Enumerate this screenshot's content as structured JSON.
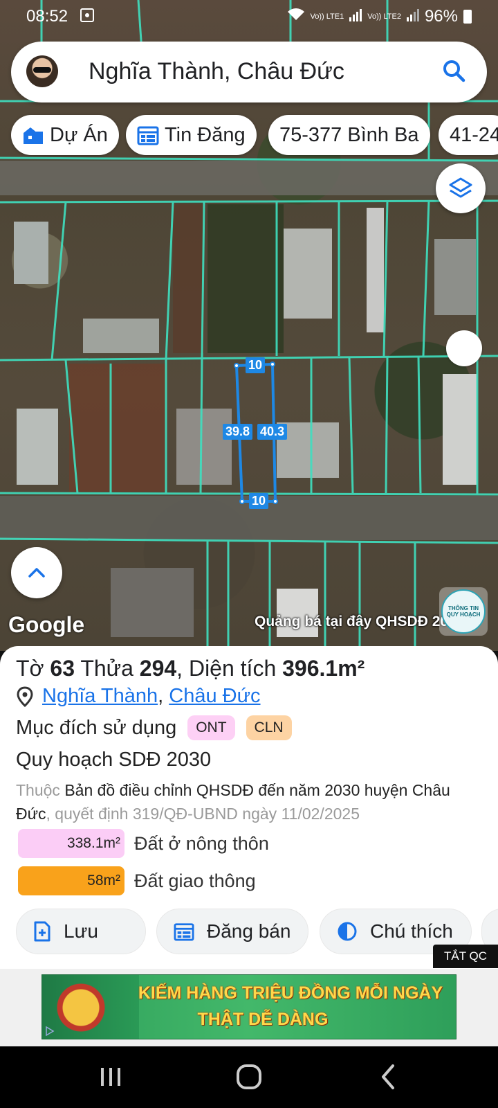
{
  "status_bar": {
    "time": "08:52",
    "signal_1": "Vo)) LTE1",
    "signal_2": "Vo)) LTE2",
    "battery": "96%"
  },
  "search": {
    "query": "Nghĩa Thành, Châu Đức",
    "search_icon": "search-icon",
    "avatar": "avatar"
  },
  "chips": [
    {
      "label": "Dự Án",
      "icon": "building-icon"
    },
    {
      "label": "Tin Đăng",
      "icon": "listing-icon"
    },
    {
      "label": "75-377 Bình Ba",
      "icon": ""
    },
    {
      "label": "41-24",
      "icon": ""
    }
  ],
  "map": {
    "measurements": {
      "top": "10",
      "bottom": "10",
      "left": "39.8",
      "right": "40.3"
    },
    "google_label": "Google",
    "promo_text": "Quảng bá tại đây QHSDĐ 2030",
    "logo_text": "THÔNG TIN QUY HOẠCH",
    "colors": {
      "boundary": "#3fe0c0",
      "parcel": "#1e88e5"
    }
  },
  "parcel": {
    "to_label": "Tờ",
    "to_value": "63",
    "thua_label": "Thửa",
    "thua_value": "294",
    "area_label": ", Diện tích",
    "area_value": "396.1m²",
    "location_1": "Nghĩa Thành",
    "location_sep": ",",
    "location_2": "Châu Đức",
    "purpose_label": "Mục đích sử dụng",
    "purpose_tags": [
      "ONT",
      "CLN"
    ],
    "plan_title": "Quy hoạch SDĐ 2030",
    "plan_prefix": "Thuộc",
    "plan_name": "Bản đồ điều chỉnh QHSDĐ đến năm 2030 huyện Châu Đức",
    "plan_decision": ", quyết định 319/QĐ-UBND ngày 11/02/2025",
    "areas": [
      {
        "value": "338.1m²",
        "label": "Đất ở nông thôn",
        "color": "#fbcdf6"
      },
      {
        "value": "58m²",
        "label": "Đất giao thông",
        "color": "#f9a21b"
      }
    ],
    "tag_colors": {
      "ONT": "#fdd0f5",
      "CLN": "#fdd3a3"
    }
  },
  "actions": [
    {
      "label": "Lưu",
      "icon": "add-file-icon"
    },
    {
      "label": "Đăng bán",
      "icon": "listing-icon"
    },
    {
      "label": "Chú thích",
      "icon": "contrast-icon"
    }
  ],
  "ad": {
    "close_label": "TẮT QC",
    "line1": "KIẾM HÀNG TRIỆU ĐỒNG MỖI NGÀY",
    "line2": "THẬT DỄ DÀNG"
  },
  "nav": {
    "recent": "recent-apps-icon",
    "home": "home-icon",
    "back": "back-icon"
  }
}
